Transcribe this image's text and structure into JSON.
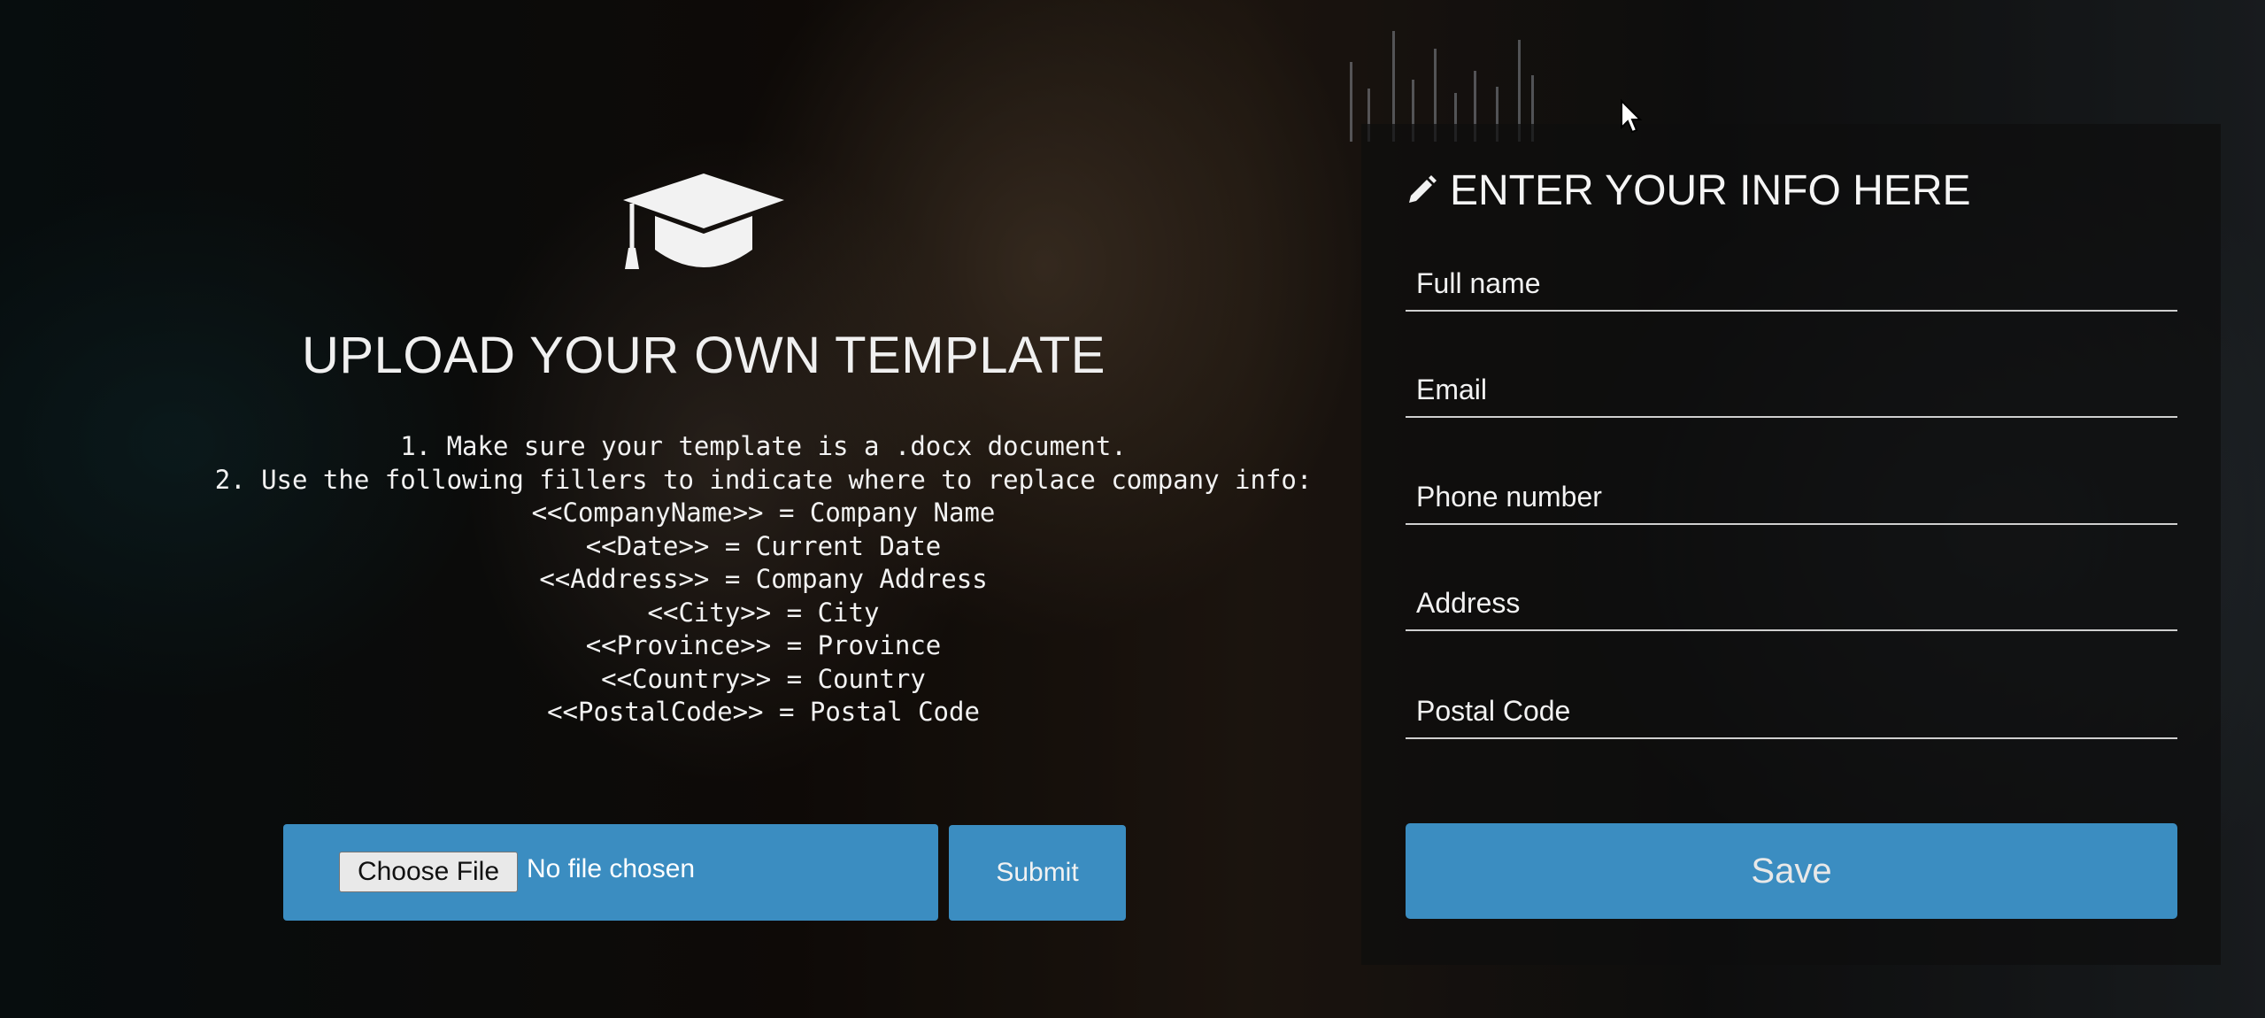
{
  "upload": {
    "icon": "graduation-cap-icon",
    "title": "UPLOAD YOUR OWN TEMPLATE",
    "instructions": [
      "1. Make sure your template is a .docx document.",
      "2. Use the following fillers to indicate where to replace company info:",
      "<<CompanyName>> = Company Name",
      "<<Date>> = Current Date",
      "<<Address>> = Company Address",
      "<<City>> = City",
      "<<Province>> = Province",
      "<<Country>> = Country",
      "<<PostalCode>> = Postal Code"
    ],
    "choose_file_label": "Choose File",
    "no_file_text": "No file chosen",
    "submit_label": "Submit"
  },
  "info_form": {
    "icon": "pencil-icon",
    "heading": "ENTER YOUR INFO HERE",
    "fields": [
      {
        "placeholder": "Full name",
        "value": ""
      },
      {
        "placeholder": "Email",
        "value": ""
      },
      {
        "placeholder": "Phone number",
        "value": ""
      },
      {
        "placeholder": "Address",
        "value": ""
      },
      {
        "placeholder": "Postal Code",
        "value": ""
      }
    ],
    "save_label": "Save"
  },
  "colors": {
    "button_blue": "#3b8dc1",
    "panel_bg": "#0e0e0e",
    "text": "#f2f2f2"
  }
}
